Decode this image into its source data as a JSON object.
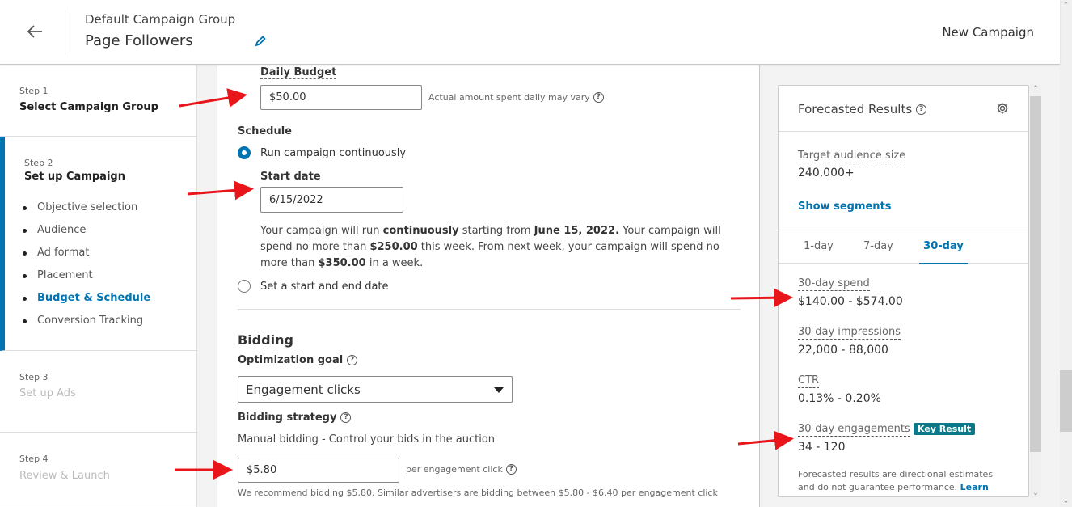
{
  "header": {
    "campaign_group": "Default Campaign Group",
    "campaign_name": "Page Followers",
    "right_title": "New Campaign"
  },
  "sidebar": {
    "steps": [
      {
        "num": "Step 1",
        "name": "Select Campaign Group",
        "state": "complete"
      },
      {
        "num": "Step 2",
        "name": "Set up Campaign",
        "state": "current",
        "substeps": [
          {
            "label": "Objective selection",
            "active": false
          },
          {
            "label": "Audience",
            "active": false
          },
          {
            "label": "Ad format",
            "active": false
          },
          {
            "label": "Placement",
            "active": false
          },
          {
            "label": "Budget & Schedule",
            "active": true
          },
          {
            "label": "Conversion Tracking",
            "active": false
          }
        ]
      },
      {
        "num": "Step 3",
        "name": "Set up Ads",
        "state": "disabled"
      },
      {
        "num": "Step 4",
        "name": "Review & Launch",
        "state": "disabled"
      }
    ]
  },
  "budget": {
    "daily_budget_label": "Daily Budget",
    "daily_budget_value": "$50.00",
    "daily_budget_hint": "Actual amount spent daily may vary"
  },
  "schedule": {
    "title": "Schedule",
    "option_continuous": "Run campaign continuously",
    "continuous_selected": true,
    "start_date_label": "Start date",
    "start_date_value": "6/15/2022",
    "desc_1": "Your campaign will run ",
    "desc_bold_1": "continuously",
    "desc_2": " starting from ",
    "desc_bold_2": "June 15, 2022.",
    "desc_3": " Your campaign will spend no more than ",
    "desc_bold_3": "$250.00",
    "desc_4": " this week. From next week, your campaign will spend no more than ",
    "desc_bold_4": "$350.00",
    "desc_5": " in a week.",
    "option_start_end": "Set a start and end date"
  },
  "bidding": {
    "title": "Bidding",
    "optimization_goal_label": "Optimization goal",
    "optimization_goal_value": "Engagement clicks",
    "strategy_label": "Bidding strategy",
    "strategy_link": "Manual bidding",
    "strategy_desc": " - Control your bids in the auction",
    "bid_value": "$5.80",
    "bid_unit": "per engagement click",
    "recommendation": "We recommend bidding $5.80. Similar advertisers are bidding between $5.80 - $6.40 per engagement click"
  },
  "forecast": {
    "title": "Forecasted Results",
    "audience_label": "Target audience size",
    "audience_value": "240,000+",
    "show_segments": "Show segments",
    "tabs": [
      "1-day",
      "7-day",
      "30-day"
    ],
    "active_tab": "30-day",
    "metrics": [
      {
        "label": "30-day spend",
        "value": "$140.00 - $574.00"
      },
      {
        "label": "30-day impressions",
        "value": "22,000 - 88,000"
      },
      {
        "label": "CTR",
        "value": "0.13% - 0.20%"
      },
      {
        "label": "30-day engagements",
        "value": "34 - 120"
      }
    ],
    "key_result_badge": "Key Result",
    "footer": "Forecasted results are directional estimates and do not guarantee performance.",
    "learn_more": "Learn more"
  },
  "colors": {
    "accent": "#0073b1",
    "badge": "#0a7a8a",
    "annotation_arrow": "#e8151b"
  }
}
